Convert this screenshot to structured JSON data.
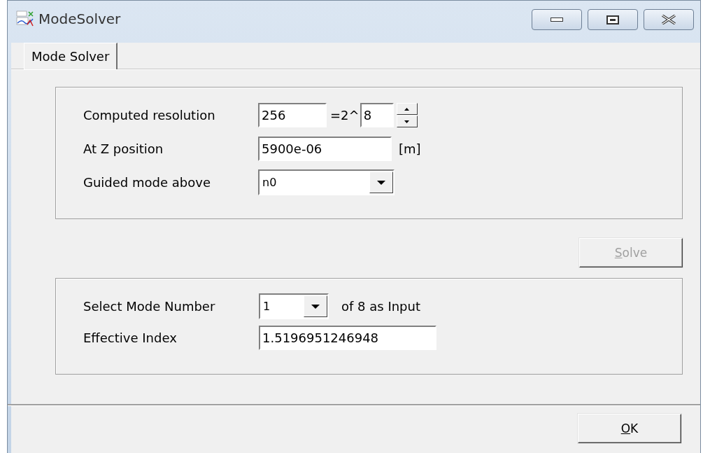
{
  "window": {
    "title": "ModeSolver"
  },
  "tabs": [
    {
      "label": "Mode Solver",
      "selected": true
    }
  ],
  "solver_settings": {
    "computed_resolution": {
      "label": "Computed resolution",
      "value": "256",
      "power_prefix": "=2^",
      "exponent": "8"
    },
    "z_position": {
      "label": "At Z position",
      "value": "5900e-06",
      "unit": "[m]"
    },
    "guided_mode": {
      "label": "Guided mode above",
      "value": "n0"
    }
  },
  "solve_button": {
    "label_parts": [
      {
        "text": "S",
        "underlined": true
      },
      {
        "text": "olve",
        "underlined": false
      }
    ],
    "disabled": true
  },
  "output": {
    "mode_number": {
      "label": "Select Mode Number",
      "value": "1",
      "suffix": "of 8 as Input"
    },
    "effective_index": {
      "label": "Effective Index",
      "value": "1.5196951246948"
    }
  },
  "ok_button": {
    "label_parts": [
      {
        "text": "O",
        "underlined": true
      },
      {
        "text": "K",
        "underlined": false
      }
    ],
    "disabled": false
  }
}
